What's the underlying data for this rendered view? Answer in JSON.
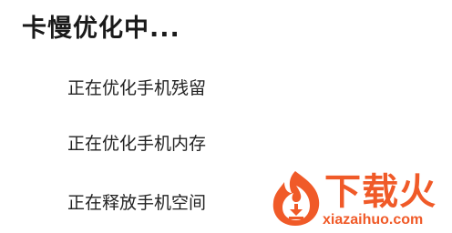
{
  "dialog": {
    "title": "卡慢优化中...",
    "progress_items": [
      "正在优化手机残留",
      "正在优化手机内存",
      "正在释放手机空间"
    ]
  },
  "watermark": {
    "brand": "下载火",
    "domain": "xiazaihuo.com",
    "color": "#f05a28",
    "icon": "flame-download-logo"
  }
}
